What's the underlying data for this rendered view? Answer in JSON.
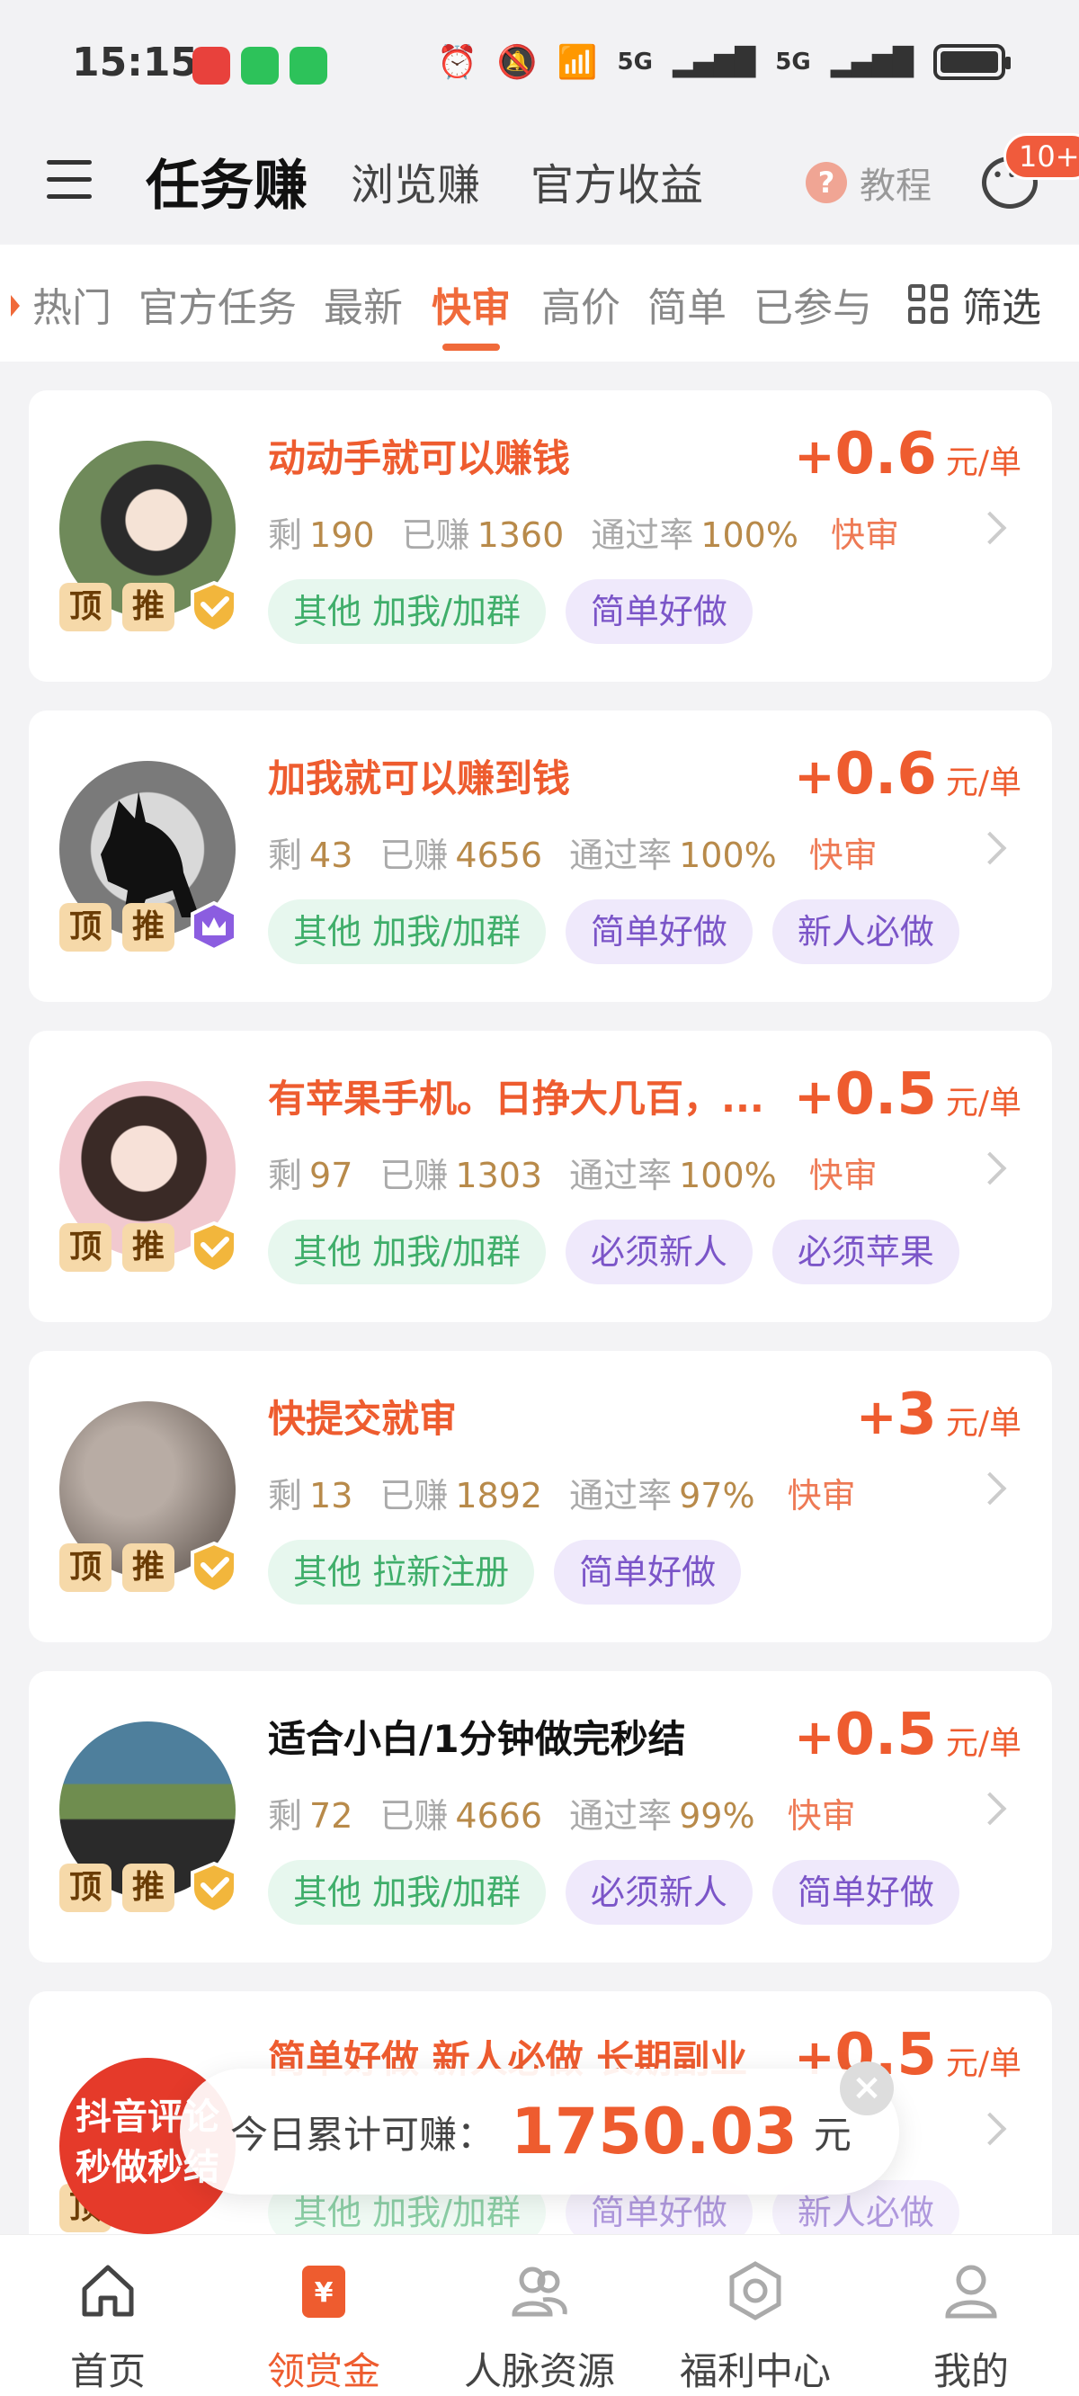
{
  "status_bar": {
    "time": "15:15",
    "network": "5G",
    "icons": [
      "alarm-icon",
      "mute-icon",
      "wifi-icon",
      "signal-icon",
      "battery-icon"
    ]
  },
  "header": {
    "tabs": [
      "任务赚",
      "浏览赚",
      "官方收益"
    ],
    "active_tab": "任务赚",
    "help_label": "教程",
    "message_badge": "10+"
  },
  "categories": {
    "items": [
      "热门",
      "官方任务",
      "最新",
      "快审",
      "高价",
      "简单",
      "已参与"
    ],
    "active": "快审",
    "filter_label": "筛选"
  },
  "task_labels": {
    "remaining": "剩",
    "earned": "已赚",
    "pass_rate": "通过率",
    "unit": "元/单",
    "top": "顶",
    "recommend": "推"
  },
  "tasks": [
    {
      "title": "动动手就可以赚钱",
      "price": "0.6",
      "remaining": "190",
      "earned": "1360",
      "pass_rate": "100%",
      "speed": "快审",
      "tags": [
        {
          "text": "其他 加我/加群",
          "kind": "green"
        },
        {
          "text": "简单好做",
          "kind": "purple"
        }
      ]
    },
    {
      "title": "加我就可以赚到钱",
      "price": "0.6",
      "remaining": "43",
      "earned": "4656",
      "pass_rate": "100%",
      "speed": "快审",
      "tags": [
        {
          "text": "其他 加我/加群",
          "kind": "green"
        },
        {
          "text": "简单好做",
          "kind": "purple"
        },
        {
          "text": "新人必做",
          "kind": "purple"
        }
      ]
    },
    {
      "title": "有苹果手机。日挣大几百，...",
      "price": "0.5",
      "remaining": "97",
      "earned": "1303",
      "pass_rate": "100%",
      "speed": "快审",
      "tags": [
        {
          "text": "其他 加我/加群",
          "kind": "green"
        },
        {
          "text": "必须新人",
          "kind": "purple"
        },
        {
          "text": "必须苹果",
          "kind": "purple"
        }
      ]
    },
    {
      "title": "快提交就审",
      "price": "3",
      "remaining": "13",
      "earned": "1892",
      "pass_rate": "97%",
      "speed": "快审",
      "tags": [
        {
          "text": "其他 拉新注册",
          "kind": "green"
        },
        {
          "text": "简单好做",
          "kind": "purple"
        }
      ]
    },
    {
      "title": "适合小白/1分钟做完秒结",
      "price": "0.5",
      "remaining": "72",
      "earned": "4666",
      "pass_rate": "99%",
      "speed": "快审",
      "tags": [
        {
          "text": "其他 加我/加群",
          "kind": "green"
        },
        {
          "text": "必须新人",
          "kind": "purple"
        },
        {
          "text": "简单好做",
          "kind": "purple"
        }
      ]
    },
    {
      "title": "简单好做 新人必做 长期副业",
      "price": "0.5",
      "remaining": "",
      "earned": "",
      "pass_rate": "",
      "speed": "",
      "tags": [
        {
          "text": "其他 加我/加群",
          "kind": "green"
        },
        {
          "text": "简单好做",
          "kind": "purple"
        },
        {
          "text": "新人必做",
          "kind": "purple"
        }
      ]
    }
  ],
  "promo_avatar_text": "抖音评论 秒做秒结",
  "earnings_banner": {
    "label": "今日累计可赚：",
    "amount": "1750.03",
    "unit": "元"
  },
  "bottom_nav": {
    "items": [
      {
        "label": "首页",
        "icon": "home-icon"
      },
      {
        "label": "领赏金",
        "icon": "bounty-icon"
      },
      {
        "label": "人脉资源",
        "icon": "contacts-icon"
      },
      {
        "label": "福利中心",
        "icon": "welfare-icon"
      },
      {
        "label": "我的",
        "icon": "profile-icon"
      }
    ],
    "active": "领赏金"
  },
  "colors": {
    "accent": "#ee5c2f",
    "green_chip": "#3fae6a",
    "purple_chip": "#7b55c8",
    "gold_tag": "#f6d9a9"
  }
}
